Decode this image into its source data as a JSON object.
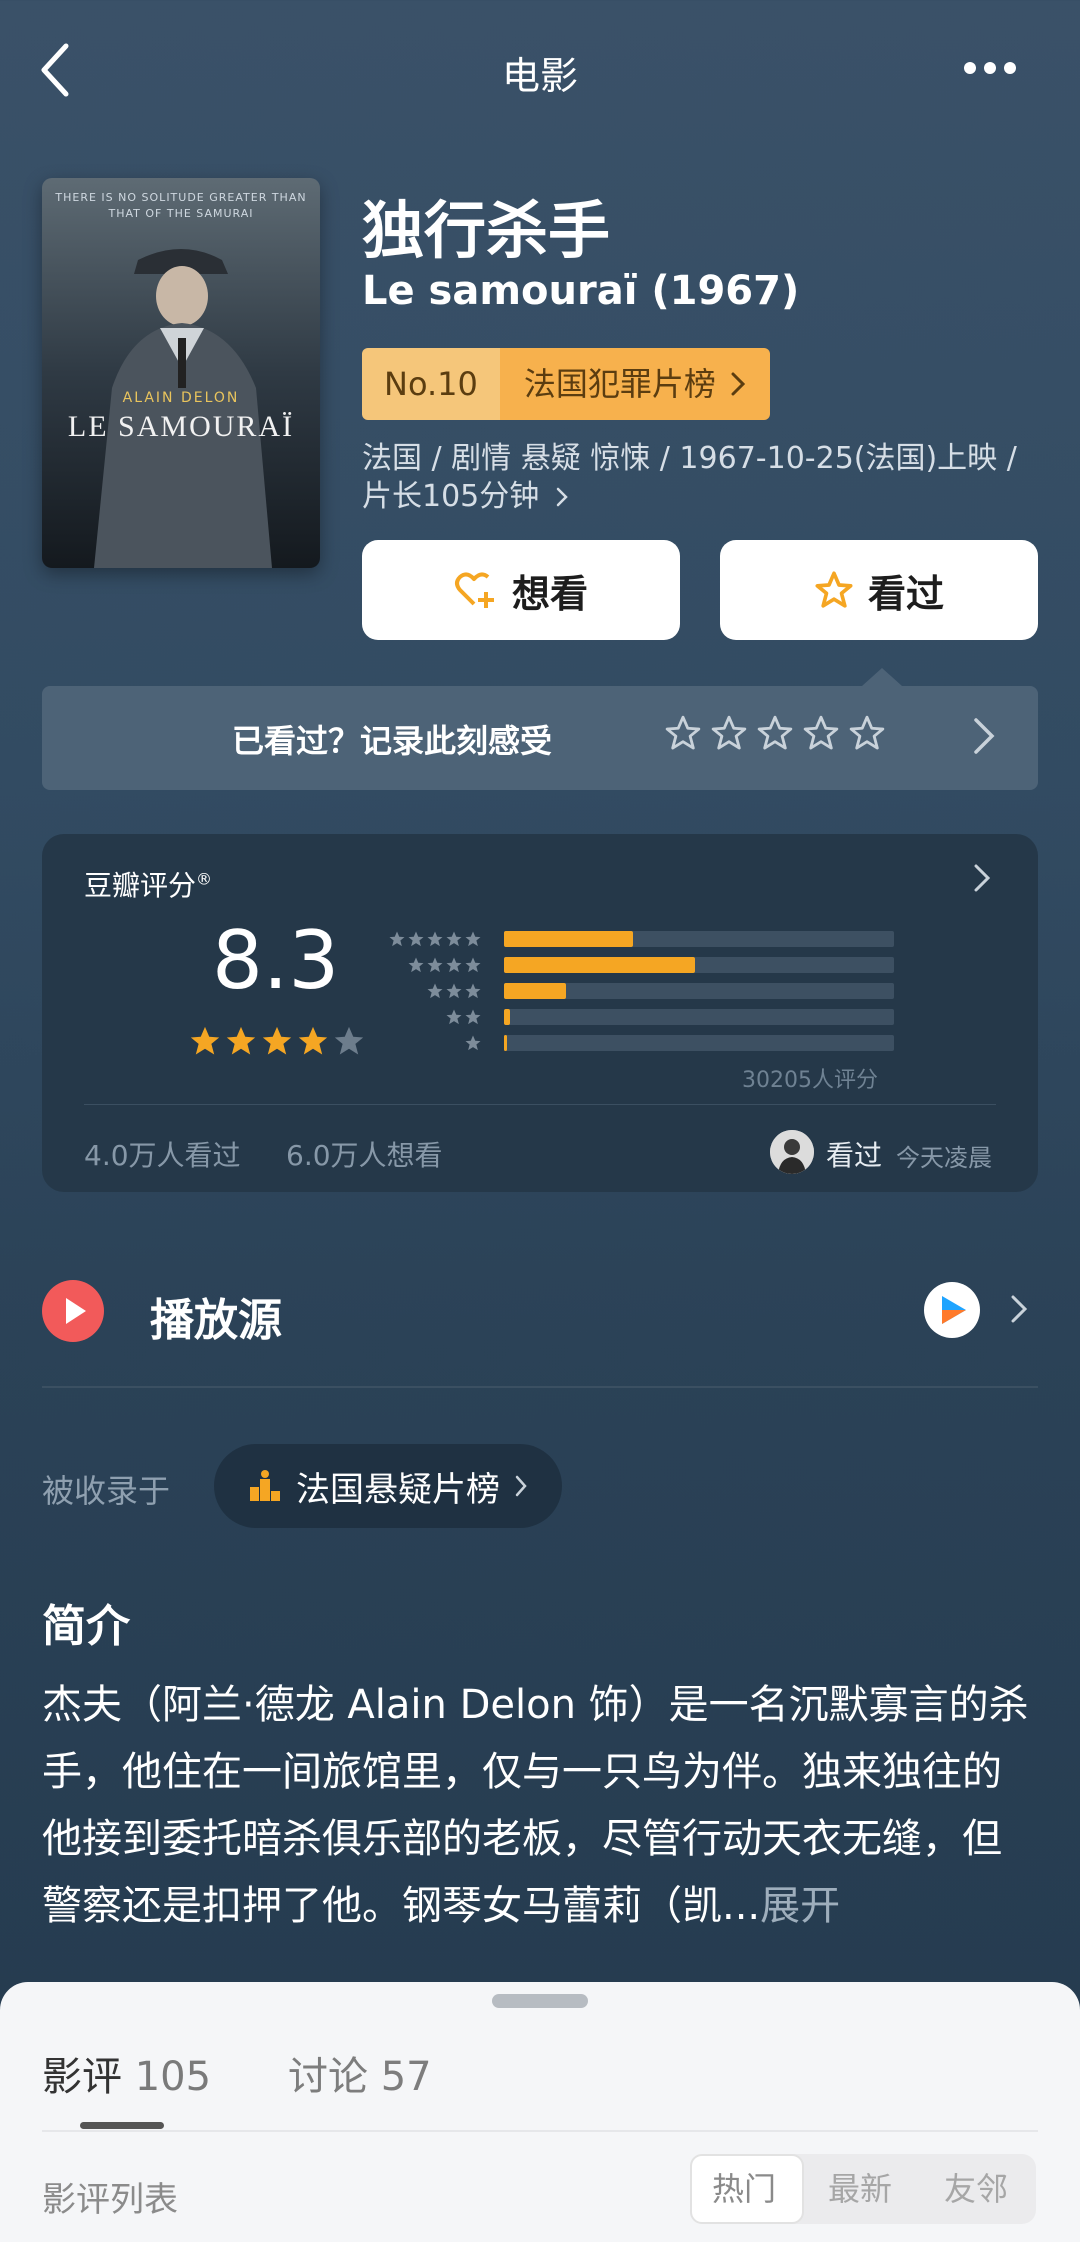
{
  "header": {
    "title": "电影"
  },
  "poster": {
    "tagline": "THERE IS NO SOLITUDE GREATER THAN THAT OF THE SAMURAI",
    "actor": "ALAIN DELON",
    "title": "LE SAMOURAÏ"
  },
  "movie": {
    "title_cn": "独行杀手",
    "title_en": "Le samouraï (1967)",
    "rank_no": "No.10",
    "rank_list": "法国犯罪片榜",
    "meta": "法国 / 剧情 悬疑 惊悚 / 1967-10-25(法国)上映 / 片长105分钟"
  },
  "actions": {
    "want": "想看",
    "seen": "看过"
  },
  "record": {
    "text": "已看过？记录此刻感受"
  },
  "rating": {
    "label": "豆瓣评分",
    "score": "8.3",
    "stars": 4.0,
    "distribution": [
      {
        "stars": 5,
        "fraction": 0.33
      },
      {
        "stars": 4,
        "fraction": 0.49
      },
      {
        "stars": 3,
        "fraction": 0.16
      },
      {
        "stars": 2,
        "fraction": 0.015
      },
      {
        "stars": 1,
        "fraction": 0.006
      }
    ],
    "count": "30205人评分",
    "seen_count": "4.0万人看过",
    "want_count": "6.0万人想看",
    "friend_status": "看过",
    "friend_time": "今天凌晨"
  },
  "play": {
    "label": "播放源"
  },
  "collection": {
    "label": "被收录于",
    "chip": "法国悬疑片榜"
  },
  "intro": {
    "title": "简介",
    "text": "杰夫（阿兰·德龙 Alain Delon 饰）是一名沉默寡言的杀手，他住在一间旅馆里，仅与一只鸟为伴。独来独往的他接到委托暗杀俱乐部的老板，尽管行动天衣无缝，但警察还是扣押了他。钢琴女马蕾莉（凯...",
    "expand": "展开"
  },
  "sheet": {
    "tab_review": "影评",
    "tab_review_count": "105",
    "tab_discuss": "讨论 57",
    "list_label": "影评列表",
    "seg": [
      "热门",
      "最新",
      "友邻"
    ]
  },
  "colors": {
    "accent": "#f5a623",
    "rank_bg": "#f7b14d",
    "play_red": "#f25a5a"
  }
}
